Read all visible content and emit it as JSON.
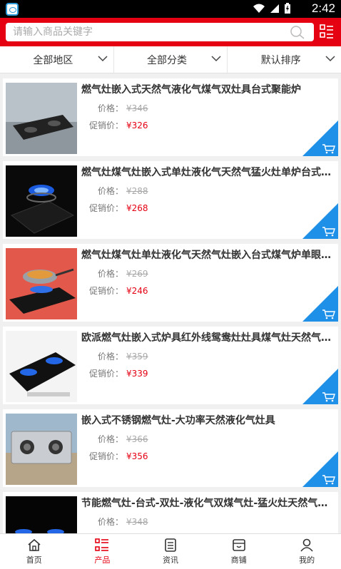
{
  "status": {
    "time": "2:42"
  },
  "search": {
    "placeholder": "请输入商品关键字"
  },
  "filters": [
    "全部地区",
    "全部分类",
    "默认排序"
  ],
  "labels": {
    "price": "价格：",
    "sale": "促销价："
  },
  "products": [
    {
      "title": "燃气灶嵌入式天然气液化气煤气双灶具台式聚能炉",
      "price": "346",
      "sale": "326"
    },
    {
      "title": "燃气灶煤气灶嵌入式单灶液化气天然气猛火灶单炉台式...",
      "price": "288",
      "sale": "268"
    },
    {
      "title": "燃气灶煤气灶单灶液化气天然气灶嵌入台式煤气炉单眼...",
      "price": "269",
      "sale": "246"
    },
    {
      "title": "欧派燃气灶嵌入式炉具红外线鸳鸯灶灶具煤气灶天然气...",
      "price": "359",
      "sale": "339"
    },
    {
      "title": "嵌入式不锈钢燃气灶-大功率天然液化气灶具",
      "price": "366",
      "sale": "356"
    },
    {
      "title": "节能燃气灶-台式-双灶-液化气双煤气灶-猛火灶天然气炉-...",
      "price": "348",
      "sale": ""
    }
  ],
  "tabs": [
    {
      "label": "首页",
      "icon": "home-icon"
    },
    {
      "label": "产品",
      "icon": "product-list-icon"
    },
    {
      "label": "资讯",
      "icon": "news-icon"
    },
    {
      "label": "商铺",
      "icon": "store-icon"
    },
    {
      "label": "我的",
      "icon": "user-icon"
    }
  ],
  "colors": {
    "brand": "#e50012",
    "cart": "#1e90e8"
  }
}
